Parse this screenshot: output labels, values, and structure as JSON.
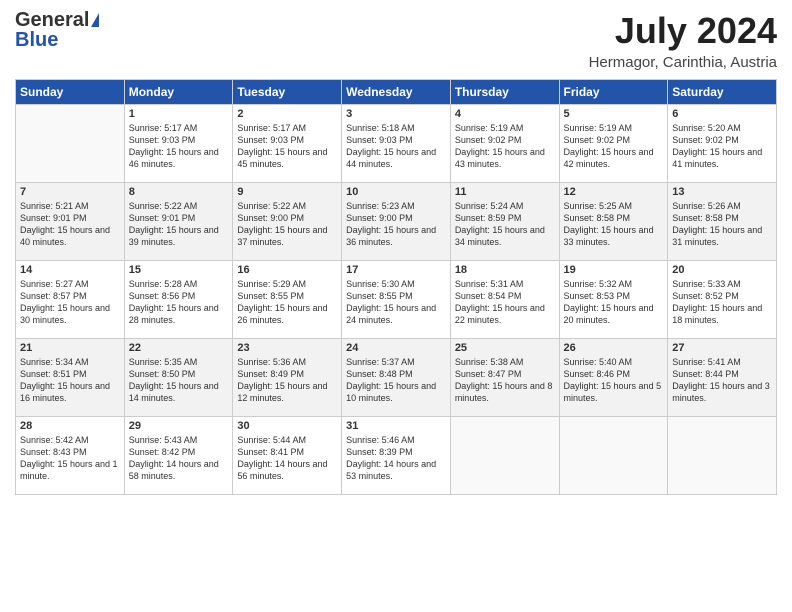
{
  "header": {
    "logo_general": "General",
    "logo_blue": "Blue",
    "month": "July 2024",
    "location": "Hermagor, Carinthia, Austria"
  },
  "days_of_week": [
    "Sunday",
    "Monday",
    "Tuesday",
    "Wednesday",
    "Thursday",
    "Friday",
    "Saturday"
  ],
  "weeks": [
    [
      {
        "day": "",
        "empty": true
      },
      {
        "day": "1",
        "sunrise": "5:17 AM",
        "sunset": "9:03 PM",
        "daylight": "15 hours and 46 minutes."
      },
      {
        "day": "2",
        "sunrise": "5:17 AM",
        "sunset": "9:03 PM",
        "daylight": "15 hours and 45 minutes."
      },
      {
        "day": "3",
        "sunrise": "5:18 AM",
        "sunset": "9:03 PM",
        "daylight": "15 hours and 44 minutes."
      },
      {
        "day": "4",
        "sunrise": "5:19 AM",
        "sunset": "9:02 PM",
        "daylight": "15 hours and 43 minutes."
      },
      {
        "day": "5",
        "sunrise": "5:19 AM",
        "sunset": "9:02 PM",
        "daylight": "15 hours and 42 minutes."
      },
      {
        "day": "6",
        "sunrise": "5:20 AM",
        "sunset": "9:02 PM",
        "daylight": "15 hours and 41 minutes."
      }
    ],
    [
      {
        "day": "7",
        "sunrise": "5:21 AM",
        "sunset": "9:01 PM",
        "daylight": "15 hours and 40 minutes."
      },
      {
        "day": "8",
        "sunrise": "5:22 AM",
        "sunset": "9:01 PM",
        "daylight": "15 hours and 39 minutes."
      },
      {
        "day": "9",
        "sunrise": "5:22 AM",
        "sunset": "9:00 PM",
        "daylight": "15 hours and 37 minutes."
      },
      {
        "day": "10",
        "sunrise": "5:23 AM",
        "sunset": "9:00 PM",
        "daylight": "15 hours and 36 minutes."
      },
      {
        "day": "11",
        "sunrise": "5:24 AM",
        "sunset": "8:59 PM",
        "daylight": "15 hours and 34 minutes."
      },
      {
        "day": "12",
        "sunrise": "5:25 AM",
        "sunset": "8:58 PM",
        "daylight": "15 hours and 33 minutes."
      },
      {
        "day": "13",
        "sunrise": "5:26 AM",
        "sunset": "8:58 PM",
        "daylight": "15 hours and 31 minutes."
      }
    ],
    [
      {
        "day": "14",
        "sunrise": "5:27 AM",
        "sunset": "8:57 PM",
        "daylight": "15 hours and 30 minutes."
      },
      {
        "day": "15",
        "sunrise": "5:28 AM",
        "sunset": "8:56 PM",
        "daylight": "15 hours and 28 minutes."
      },
      {
        "day": "16",
        "sunrise": "5:29 AM",
        "sunset": "8:55 PM",
        "daylight": "15 hours and 26 minutes."
      },
      {
        "day": "17",
        "sunrise": "5:30 AM",
        "sunset": "8:55 PM",
        "daylight": "15 hours and 24 minutes."
      },
      {
        "day": "18",
        "sunrise": "5:31 AM",
        "sunset": "8:54 PM",
        "daylight": "15 hours and 22 minutes."
      },
      {
        "day": "19",
        "sunrise": "5:32 AM",
        "sunset": "8:53 PM",
        "daylight": "15 hours and 20 minutes."
      },
      {
        "day": "20",
        "sunrise": "5:33 AM",
        "sunset": "8:52 PM",
        "daylight": "15 hours and 18 minutes."
      }
    ],
    [
      {
        "day": "21",
        "sunrise": "5:34 AM",
        "sunset": "8:51 PM",
        "daylight": "15 hours and 16 minutes."
      },
      {
        "day": "22",
        "sunrise": "5:35 AM",
        "sunset": "8:50 PM",
        "daylight": "15 hours and 14 minutes."
      },
      {
        "day": "23",
        "sunrise": "5:36 AM",
        "sunset": "8:49 PM",
        "daylight": "15 hours and 12 minutes."
      },
      {
        "day": "24",
        "sunrise": "5:37 AM",
        "sunset": "8:48 PM",
        "daylight": "15 hours and 10 minutes."
      },
      {
        "day": "25",
        "sunrise": "5:38 AM",
        "sunset": "8:47 PM",
        "daylight": "15 hours and 8 minutes."
      },
      {
        "day": "26",
        "sunrise": "5:40 AM",
        "sunset": "8:46 PM",
        "daylight": "15 hours and 5 minutes."
      },
      {
        "day": "27",
        "sunrise": "5:41 AM",
        "sunset": "8:44 PM",
        "daylight": "15 hours and 3 minutes."
      }
    ],
    [
      {
        "day": "28",
        "sunrise": "5:42 AM",
        "sunset": "8:43 PM",
        "daylight": "15 hours and 1 minute."
      },
      {
        "day": "29",
        "sunrise": "5:43 AM",
        "sunset": "8:42 PM",
        "daylight": "14 hours and 58 minutes."
      },
      {
        "day": "30",
        "sunrise": "5:44 AM",
        "sunset": "8:41 PM",
        "daylight": "14 hours and 56 minutes."
      },
      {
        "day": "31",
        "sunrise": "5:46 AM",
        "sunset": "8:39 PM",
        "daylight": "14 hours and 53 minutes."
      },
      {
        "day": "",
        "empty": true
      },
      {
        "day": "",
        "empty": true
      },
      {
        "day": "",
        "empty": true
      }
    ]
  ]
}
